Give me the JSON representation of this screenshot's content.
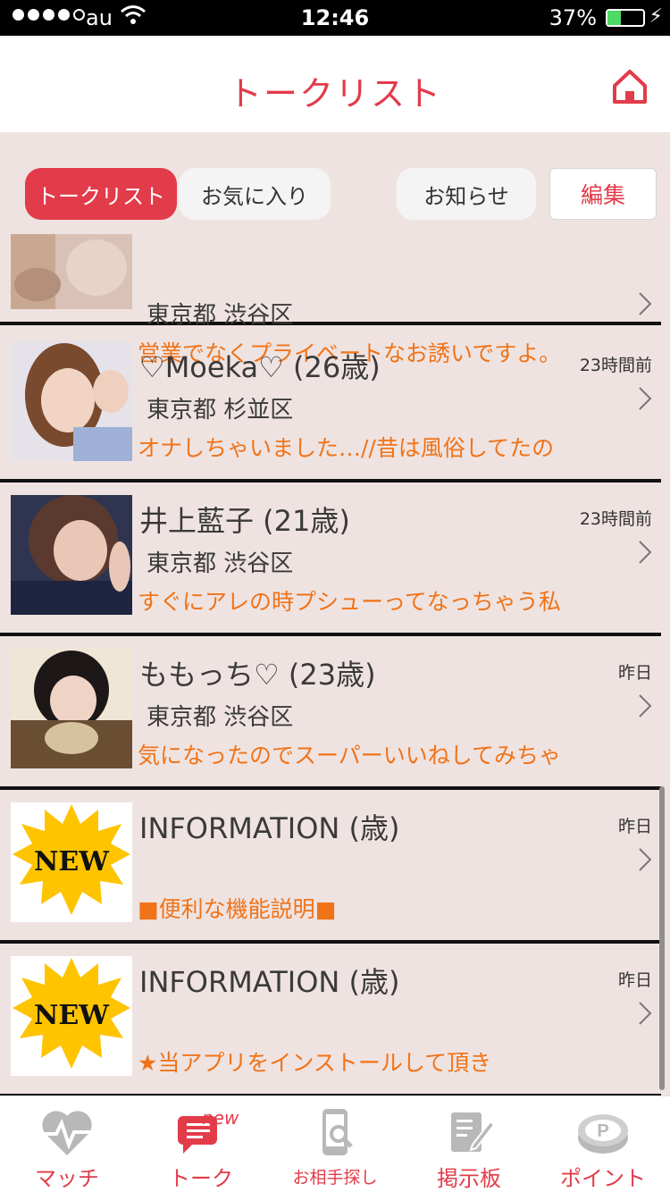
{
  "status": {
    "carrier": "au",
    "time": "12:46",
    "battery": "37%"
  },
  "header": {
    "title": "トークリスト"
  },
  "segments": {
    "talk": "トークリスト",
    "favorites": "お気に入り",
    "notice": "お知らせ",
    "edit": "編集"
  },
  "rows": [
    {
      "name": "",
      "time": "",
      "location": "東京都 渋谷区",
      "message": "営業でなくプライベートなお誘いですよ。",
      "avatar": "photo-blonde"
    },
    {
      "name": "♡Moeka♡ (26歳)",
      "time": "23時間前",
      "location": "東京都 杉並区",
      "message": "オナしちゃいました…//昔は風俗してたの",
      "avatar": "photo-brown"
    },
    {
      "name": "井上藍子 (21歳)",
      "time": "23時間前",
      "location": "東京都 渋谷区",
      "message": "すぐにアレの時プシューってなっちゃう私",
      "avatar": "photo-dark"
    },
    {
      "name": "ももっち♡ (23歳)",
      "time": "昨日",
      "location": "東京都 渋谷区",
      "message": "気になったのでスーパーいいねしてみちゃ",
      "avatar": "photo-black"
    },
    {
      "name": "INFORMATION (歳)",
      "time": "昨日",
      "location": "",
      "message": "■便利な機能説明■",
      "avatar": "new-badge"
    },
    {
      "name": "INFORMATION (歳)",
      "time": "昨日",
      "location": "",
      "message": "★当アプリをインストールして頂き",
      "avatar": "new-badge"
    }
  ],
  "new_badge_text": "NEW",
  "tabs": [
    {
      "label": "マッチ",
      "icon": "heart-pulse-icon"
    },
    {
      "label": "トーク",
      "icon": "chat-bubble-icon",
      "badge": "new"
    },
    {
      "label": "お相手探し",
      "icon": "phone-search-icon"
    },
    {
      "label": "掲示板",
      "icon": "board-icon"
    },
    {
      "label": "ポイント",
      "icon": "point-coin-icon"
    }
  ],
  "colors": {
    "accent": "#e23b4a",
    "message": "#f07318",
    "background": "#efe3e1"
  }
}
